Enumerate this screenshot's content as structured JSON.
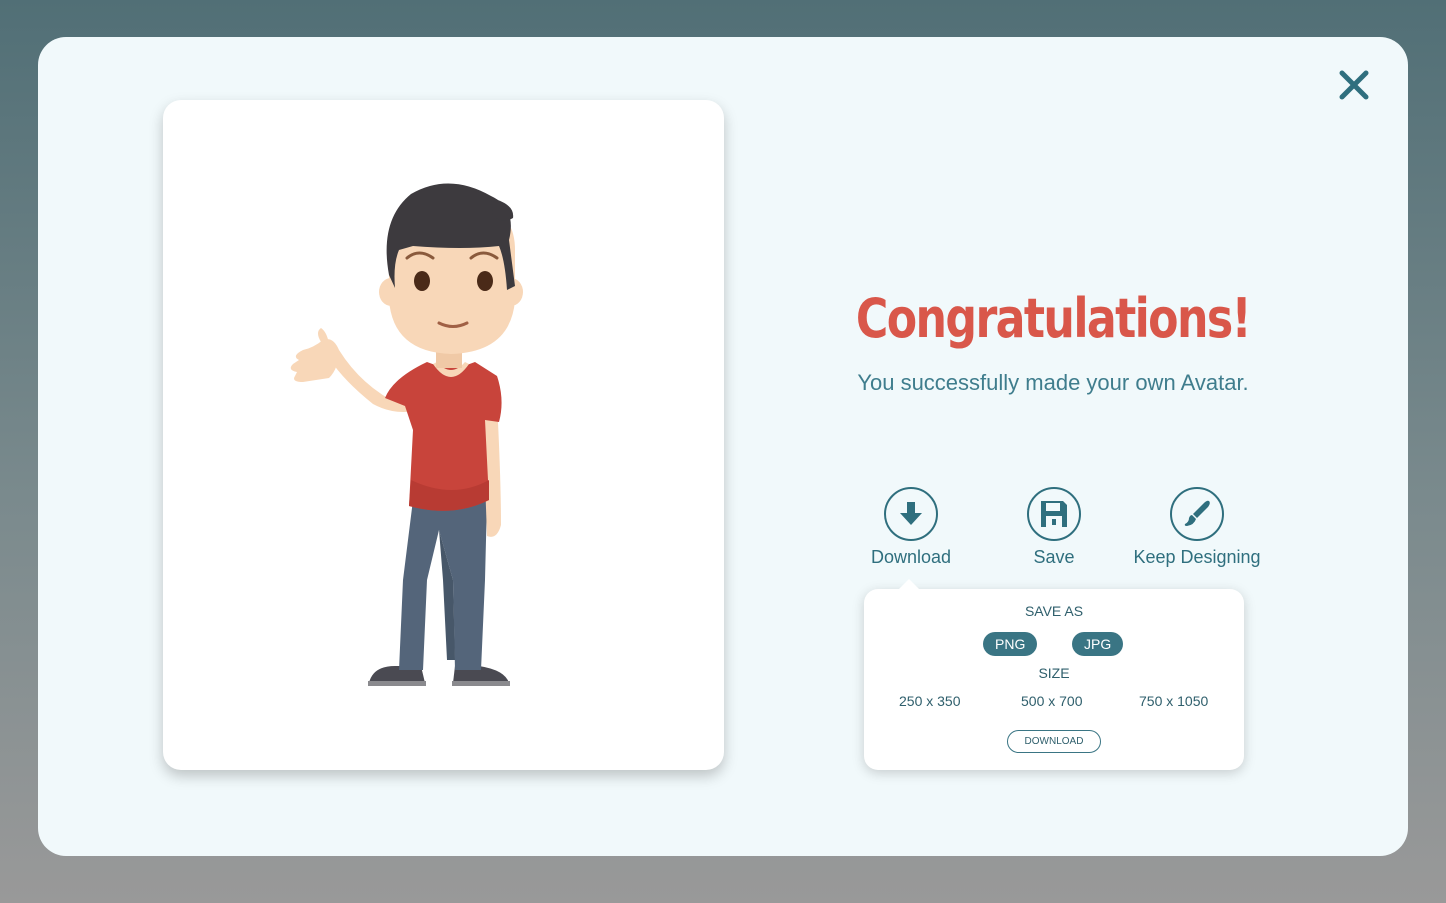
{
  "modal": {
    "close_icon": "close-icon",
    "title": "Congratulations!",
    "subtitle": "You successfully made your own Avatar.",
    "title_color": "#d9574a",
    "accent_color": "#2f6f7e"
  },
  "actions": [
    {
      "label": "Download",
      "icon": "download-icon"
    },
    {
      "label": "Save",
      "icon": "floppy-disk-icon"
    },
    {
      "label": "Keep Designing",
      "icon": "paintbrush-icon"
    }
  ],
  "download_popup": {
    "save_as_label": "SAVE AS",
    "formats": [
      "PNG",
      "JPG"
    ],
    "size_label": "SIZE",
    "sizes": [
      "250 x 350",
      "500 x 700",
      "750 x 1050"
    ],
    "download_button": "DOWNLOAD"
  }
}
